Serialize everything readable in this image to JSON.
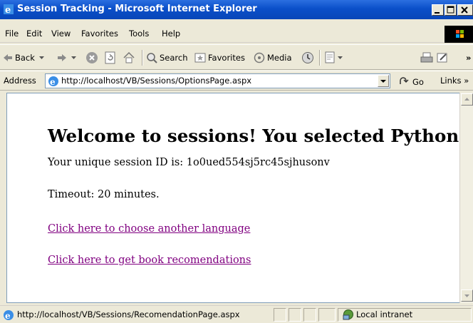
{
  "window": {
    "title": "Session Tracking - Microsoft Internet Explorer"
  },
  "menu": {
    "items": [
      "File",
      "Edit",
      "View",
      "Favorites",
      "Tools",
      "Help"
    ]
  },
  "toolbar": {
    "back": "Back",
    "search": "Search",
    "favorites": "Favorites",
    "media": "Media",
    "more": "»"
  },
  "address": {
    "label": "Address",
    "url": "http://localhost/VB/Sessions/OptionsPage.aspx",
    "go": "Go",
    "links": "Links »"
  },
  "page": {
    "heading": "Welcome to sessions! You selected Python.",
    "session_id": "Your unique session ID is: 1o0ued554sj5rc45sjhusonv",
    "timeout": "Timeout: 20 minutes.",
    "link_language": "Click here to choose another language",
    "link_books": "Click here to get book recomendations"
  },
  "status": {
    "url": "http://localhost/VB/Sessions/RecomendationPage.aspx",
    "zone": "Local intranet"
  },
  "colors": {
    "title_bar": "#0a4fc9",
    "visited_link": "#800080",
    "chrome": "#ece9d8"
  }
}
